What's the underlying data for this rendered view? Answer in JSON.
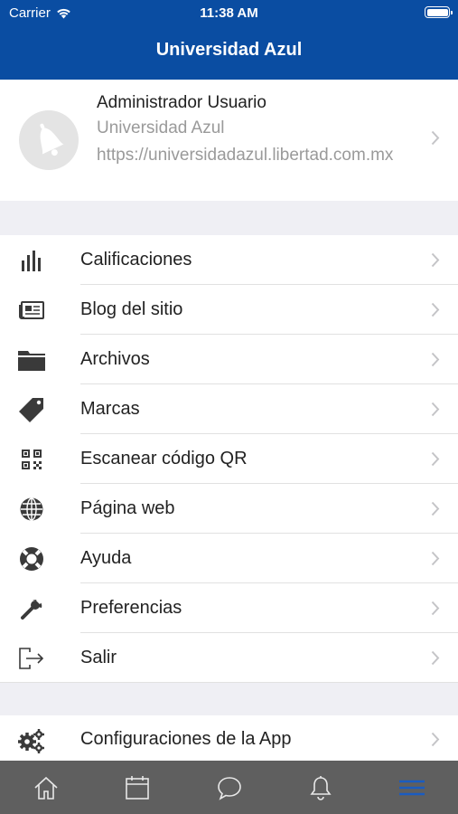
{
  "status_bar": {
    "carrier": "Carrier",
    "time": "11:38 AM"
  },
  "header": {
    "title": "Universidad Azul"
  },
  "profile": {
    "name": "Administrador Usuario",
    "site_name": "Universidad Azul",
    "site_url": "https://universidadazul.libertad.com.mx"
  },
  "menu": {
    "items": [
      {
        "label": "Calificaciones",
        "icon": "bar-chart-icon"
      },
      {
        "label": "Blog del sitio",
        "icon": "newspaper-icon"
      },
      {
        "label": "Archivos",
        "icon": "folder-icon"
      },
      {
        "label": "Marcas",
        "icon": "tag-icon"
      },
      {
        "label": "Escanear código QR",
        "icon": "qr-code-icon"
      },
      {
        "label": "Página web",
        "icon": "globe-icon"
      },
      {
        "label": "Ayuda",
        "icon": "life-ring-icon"
      },
      {
        "label": "Preferencias",
        "icon": "wrench-icon"
      },
      {
        "label": "Salir",
        "icon": "sign-out-icon"
      }
    ],
    "app_settings": {
      "label": "Configuraciones de la App",
      "icon": "gears-icon"
    }
  },
  "tabbar": {
    "tabs": [
      "home-icon",
      "calendar-icon",
      "chat-icon",
      "bell-icon",
      "menu-icon"
    ],
    "active_tab": "menu-icon"
  },
  "colors": {
    "brand": "#0a4da2",
    "tabbar_bg": "#5f5f5f",
    "active_tab": "#1a5cc0"
  }
}
